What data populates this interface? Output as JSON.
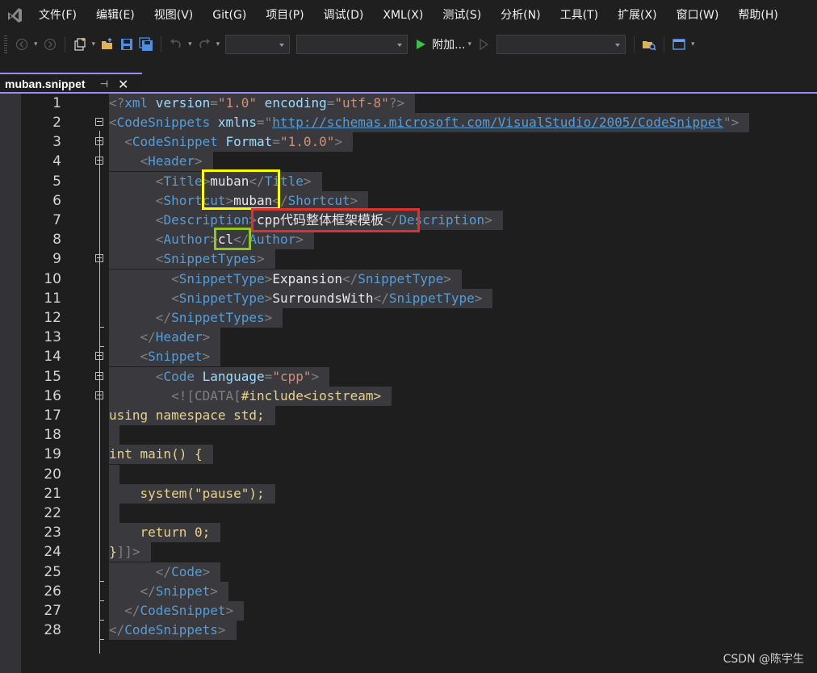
{
  "menu": {
    "items": [
      "文件(F)",
      "编辑(E)",
      "视图(V)",
      "Git(G)",
      "项目(P)",
      "调试(D)",
      "XML(X)",
      "测试(S)",
      "分析(N)",
      "工具(T)",
      "扩展(X)",
      "窗口(W)",
      "帮助(H)"
    ]
  },
  "toolbar": {
    "attach_label": "附加...",
    "icons": [
      "back-icon",
      "forward-icon",
      "new-item-icon",
      "open-folder-icon",
      "save-icon",
      "save-all-icon",
      "undo-icon",
      "redo-icon",
      "run-icon",
      "step-icon",
      "find-in-files-icon",
      "layout-icon"
    ]
  },
  "tab": {
    "title": "muban.snippet",
    "pin_icon": "pin-icon",
    "close_icon": "close-icon"
  },
  "editor": {
    "line_numbers": [
      "1",
      "2",
      "3",
      "4",
      "5",
      "6",
      "7",
      "8",
      "9",
      "10",
      "11",
      "12",
      "13",
      "14",
      "15",
      "16",
      "17",
      "18",
      "19",
      "20",
      "21",
      "22",
      "23",
      "24",
      "25",
      "26",
      "27",
      "28"
    ],
    "lines": {
      "l1": {
        "a": "<?",
        "b": "xml",
        "c": " version",
        "d": "=",
        "e": "\"1.0\"",
        "f": " encoding",
        "g": "=",
        "h": "\"utf-8\"",
        "i": "?>"
      },
      "l2": {
        "a": "<",
        "b": "CodeSnippets",
        "c": " xmlns",
        "d": "=\"",
        "e": "http://schemas.microsoft.com/VisualStudio/2005/CodeSnippet",
        "f": "\">"
      },
      "l3": {
        "a": "<",
        "b": "CodeSnippet",
        "c": " Format",
        "d": "=",
        "e": "\"1.0.0\"",
        "f": ">"
      },
      "l4": {
        "a": "<",
        "b": "Header",
        "c": ">"
      },
      "l5": {
        "a": "<",
        "b": "Title",
        "c": ">",
        "d": "muban",
        "e": "</",
        "f": "Title",
        "g": ">"
      },
      "l6": {
        "a": "<",
        "b": "Shortcut",
        "c": ">",
        "d": "muban",
        "e": "</",
        "f": "Shortcut",
        "g": ">"
      },
      "l7": {
        "a": "<",
        "b": "Description",
        "c": ">",
        "d": "cpp代码整体框架模板",
        "e": "</",
        "f": "Description",
        "g": ">"
      },
      "l8": {
        "a": "<",
        "b": "Author",
        "c": ">",
        "d": "cl",
        "e": "</",
        "f": "Author",
        "g": ">"
      },
      "l9": {
        "a": "<",
        "b": "SnippetTypes",
        "c": ">"
      },
      "l10": {
        "a": "<",
        "b": "SnippetType",
        "c": ">",
        "d": "Expansion",
        "e": "</",
        "f": "SnippetType",
        "g": ">"
      },
      "l11": {
        "a": "<",
        "b": "SnippetType",
        "c": ">",
        "d": "SurroundsWith",
        "e": "</",
        "f": "SnippetType",
        "g": ">"
      },
      "l12": {
        "a": "</",
        "b": "SnippetTypes",
        "c": ">"
      },
      "l13": {
        "a": "</",
        "b": "Header",
        "c": ">"
      },
      "l14": {
        "a": "<",
        "b": "Snippet",
        "c": ">"
      },
      "l15": {
        "a": "<",
        "b": "Code",
        "c": " Language",
        "d": "=",
        "e": "\"cpp\"",
        "f": ">"
      },
      "l16": {
        "a": "<![",
        "b": "CDATA",
        "c": "[",
        "d": "#include<iostream>"
      },
      "l17": "using namespace std;",
      "l18": "",
      "l19": "int main() {",
      "l20": "",
      "l21": "    system(\"pause\");",
      "l22": "",
      "l23": "    return 0;",
      "l24": {
        "a": "}",
        "b": "]]>"
      },
      "l25": {
        "a": "</",
        "b": "Code",
        "c": ">"
      },
      "l26": {
        "a": "</",
        "b": "Snippet",
        "c": ">"
      },
      "l27": {
        "a": "</",
        "b": "CodeSnippet",
        "c": ">"
      },
      "l28": {
        "a": "</",
        "b": "CodeSnippets",
        "c": ">"
      }
    }
  },
  "annotations": {
    "colors": {
      "yellow": "#ffff00",
      "red": "#e0312f",
      "green": "#8fc71e"
    }
  },
  "watermark": "CSDN @陈宇生"
}
